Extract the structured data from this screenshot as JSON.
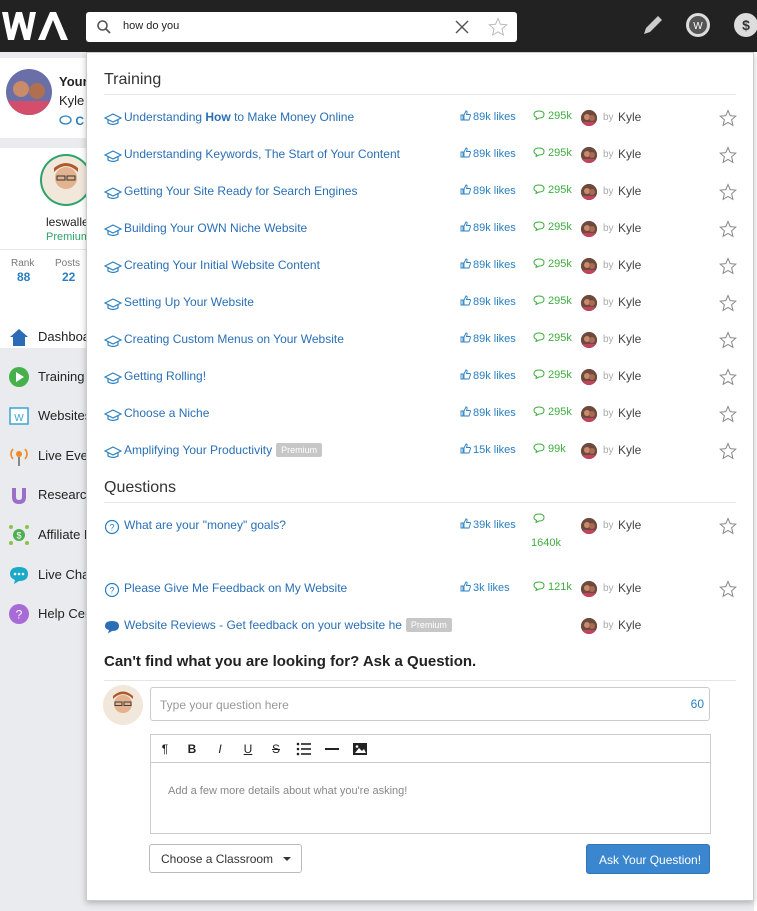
{
  "search": {
    "query": "how do you"
  },
  "sidebar": {
    "profile_name": "Your",
    "profile_sub": "Kyle",
    "profile_link": "C",
    "username": "leswalle",
    "membership": "Premium",
    "rank_label": "Rank",
    "rank_value": "88",
    "posts_label": "Posts",
    "posts_value": "22",
    "nav": [
      "Dashboa",
      "Training",
      "Websites",
      "Live Eve",
      "Research",
      "Affiliate P",
      "Live Cha",
      "Help Cen"
    ]
  },
  "training": {
    "title": "Training",
    "items": [
      {
        "pre": "Understanding ",
        "bold": "How",
        "post": " to Make Money Online",
        "likes": "89k likes",
        "comments": "295k",
        "by": "by",
        "author": "Kyle"
      },
      {
        "pre": "Understanding Keywords, The Start of Your Content",
        "bold": "",
        "post": "",
        "likes": "89k likes",
        "comments": "295k",
        "by": "by",
        "author": "Kyle"
      },
      {
        "pre": "Getting Your Site Ready for Search Engines",
        "bold": "",
        "post": "",
        "likes": "89k likes",
        "comments": "295k",
        "by": "by",
        "author": "Kyle"
      },
      {
        "pre": "Building Your OWN Niche Website",
        "bold": "",
        "post": "",
        "likes": "89k likes",
        "comments": "295k",
        "by": "by",
        "author": "Kyle"
      },
      {
        "pre": "Creating Your Initial Website Content",
        "bold": "",
        "post": "",
        "likes": "89k likes",
        "comments": "295k",
        "by": "by",
        "author": "Kyle"
      },
      {
        "pre": "Setting Up Your Website",
        "bold": "",
        "post": "",
        "likes": "89k likes",
        "comments": "295k",
        "by": "by",
        "author": "Kyle"
      },
      {
        "pre": "Creating Custom Menus on Your Website",
        "bold": "",
        "post": "",
        "likes": "89k likes",
        "comments": "295k",
        "by": "by",
        "author": "Kyle"
      },
      {
        "pre": "Getting Rolling!",
        "bold": "",
        "post": "",
        "likes": "89k likes",
        "comments": "295k",
        "by": "by",
        "author": "Kyle"
      },
      {
        "pre": "Choose a Niche",
        "bold": "",
        "post": "",
        "likes": "89k likes",
        "comments": "295k",
        "by": "by",
        "author": "Kyle"
      },
      {
        "pre": "Amplifying Your Productivity",
        "bold": "",
        "post": "",
        "badge": "Premium",
        "likes": "15k likes",
        "comments": "99k",
        "by": "by",
        "author": "Kyle"
      }
    ]
  },
  "questions": {
    "title": "Questions",
    "items": [
      {
        "text": "What are your \"money\" goals?",
        "likes": "39k likes",
        "comments": "1640k",
        "by": "by",
        "author": "Kyle"
      },
      {
        "text": "Please Give Me Feedback on My Website",
        "likes": "3k likes",
        "comments": "121k",
        "by": "by",
        "author": "Kyle"
      },
      {
        "text": "Website Reviews - Get feedback on your website he",
        "badge": "Premium",
        "by": "by",
        "author": "Kyle"
      }
    ]
  },
  "ask": {
    "title": "Can't find what you are looking for? Ask a Question.",
    "placeholder": "Type your question here",
    "char_count": "60",
    "details_placeholder": "Add a few more details about what you're asking!",
    "toolbar": [
      "¶",
      "B",
      "I",
      "U",
      "S"
    ],
    "classroom_label": "Choose a Classroom",
    "submit_label": "Ask Your Question!"
  },
  "colors": {
    "link": "#2a6fb5",
    "likes": "#2a7fc0",
    "comments": "#3fae3f",
    "topbar": "#222222",
    "primary_button": "#3a87cf"
  }
}
